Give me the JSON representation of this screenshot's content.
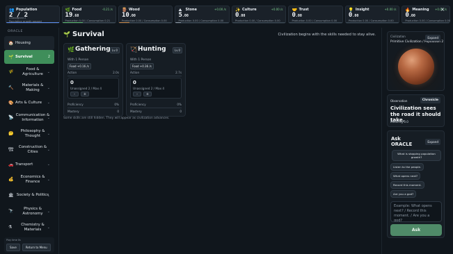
{
  "resources": [
    {
      "name": "Population",
      "icon": "👥",
      "value": "2 / 2",
      "line1": "Unassigned 2",
      "line2": "Population growth paused",
      "delta": "",
      "color": "#5b8def",
      "fill": 1.0
    },
    {
      "name": "Food",
      "icon": "🌿",
      "value": "19",
      "decimals": ".68",
      "line1": "",
      "line2": "Production 0.00 / Consumption 0.21",
      "delta": "-0.21 /s",
      "color": "#5db86f",
      "fill": 0.39
    },
    {
      "name": "Wood",
      "icon": "🪵",
      "value": "10",
      "decimals": ".00",
      "line1": "",
      "line2": "Production 0.00 / Consumption 0.00",
      "delta": "",
      "color": "#c7894a",
      "fill": 0.2
    },
    {
      "name": "Stone",
      "icon": "⛰",
      "value": "5",
      "decimals": ".00",
      "line1": "",
      "line2": "Production 0.00 / Consumption 0.00",
      "delta": "+0.00 /s",
      "color": "#8f9aa6",
      "fill": 0.1
    },
    {
      "name": "Culture",
      "icon": "✨",
      "value": "0",
      "decimals": ".00",
      "line1": "",
      "line2": "Production 0.00 / Consumption 0.00",
      "delta": "+0.00 /s",
      "color": "#a66ad6",
      "fill": 0.0
    },
    {
      "name": "Trust",
      "icon": "🤝",
      "value": "0",
      "decimals": ".00",
      "line1": "",
      "line2": "Production 0.00 / Consumption 0.00",
      "delta": "",
      "color": "#d9b341",
      "fill": 0.0
    },
    {
      "name": "Insight",
      "icon": "💡",
      "value": "0",
      "decimals": ".00",
      "line1": "",
      "line2": "Production 0.00 / Consumption 0.00",
      "delta": "+0.00 /s",
      "color": "#4fb3c8",
      "fill": 0.0
    },
    {
      "name": "Meaning",
      "icon": "🔥",
      "value": "0",
      "decimals": ".00",
      "line1": "",
      "line2": "Production 0.00 / Consumption 0.00",
      "delta": "+0.00 /s",
      "color": "#d0604b",
      "fill": 0.0
    }
  ],
  "sidebar": {
    "heading": "ORACLE",
    "items": [
      {
        "label": "Housing",
        "icon": "🏠",
        "badge": ""
      },
      {
        "label": "Survival",
        "icon": "🌱",
        "badge": "2"
      },
      {
        "label": "Food & Agriculture",
        "icon": "🌾",
        "badge": ""
      },
      {
        "label": "Materials & Making",
        "icon": "🔨",
        "badge": ""
      },
      {
        "label": "Arts & Culture",
        "icon": "🎨",
        "badge": ""
      },
      {
        "label": "Communication & Information",
        "icon": "📡",
        "badge": ""
      },
      {
        "label": "Philosophy & Thought",
        "icon": "🤔",
        "badge": ""
      },
      {
        "label": "Construction & Cities",
        "icon": "🏗",
        "badge": ""
      },
      {
        "label": "Transport",
        "icon": "🚗",
        "badge": ""
      },
      {
        "label": "Economics & Finance",
        "icon": "💰",
        "badge": ""
      },
      {
        "label": "Society & Politics",
        "icon": "🏛",
        "badge": ""
      },
      {
        "label": "Physics & Astronomy",
        "icon": "🔭",
        "badge": ""
      },
      {
        "label": "Chemistry & Materials",
        "icon": "⚗",
        "badge": ""
      }
    ],
    "footer_text": "Play time 0s",
    "save_label": "Save",
    "menu_label": "Return to Menu"
  },
  "main": {
    "title": "Survival",
    "tagline": "Civilization begins with the skills needed to stay alive.",
    "skills": [
      {
        "name": "Gathering",
        "icon": "🌿",
        "level": "Lv.0",
        "with": "With 1 Person",
        "rate": "Food +0.16 /s",
        "action_label": "Action",
        "action_value": "2.0s",
        "count": "0",
        "unassigned": "Unassigned 2 / Max 4",
        "minus": "-",
        "plus": "+",
        "proficiency_label": "Proficiency",
        "proficiency_value": "0%",
        "mastery_label": "Mastery",
        "mastery_value": "0"
      },
      {
        "name": "Hunting",
        "icon": "🏹",
        "level": "Lv.0",
        "with": "With 1 Person",
        "rate": "Food +0.36 /s",
        "action_label": "Action",
        "action_value": "2.7s",
        "count": "0",
        "unassigned": "Unassigned 2 / Max 4",
        "minus": "-",
        "plus": "+",
        "proficiency_label": "Proficiency",
        "proficiency_value": "0%",
        "mastery_label": "Mastery",
        "mastery_value": "0"
      }
    ],
    "note": "Some skills are still hidden. They will appear as civilization advances."
  },
  "right": {
    "civ_label": "Civilization",
    "civ_sub": "Primitive Civilization / Population 2",
    "expand_label": "Expand",
    "observation_label": "Observation",
    "chronicle_label": "Chronicle",
    "observation_text": "Civilization sees the road it should take.",
    "meaning": "Meaning 0.0",
    "ask_title": "Ask ORACLE",
    "ask_expand": "Expand",
    "chips": [
      "What is stopping population growth?",
      "Listen to the people.",
      "What opens next?",
      "Record this moment.",
      "Are you a god?"
    ],
    "input_placeholder": "Example: What opens next? / Record this moment. / Are you a god?",
    "ask_button": "Ask"
  },
  "close_label": "×"
}
